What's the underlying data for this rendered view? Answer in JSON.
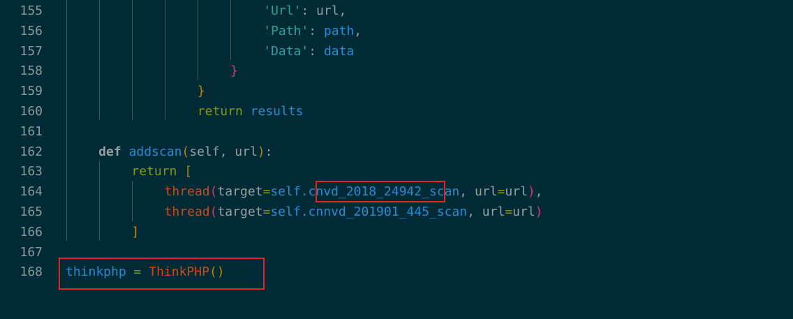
{
  "editor": {
    "lines": [
      {
        "num": "155",
        "parts": [
          [
            "str",
            "'Url'"
          ],
          [
            "name",
            ": url,"
          ]
        ]
      },
      {
        "num": "156",
        "parts": [
          [
            "str",
            "'Path'"
          ],
          [
            "name",
            ": "
          ],
          [
            "attr",
            "path"
          ],
          [
            "name",
            ","
          ]
        ]
      },
      {
        "num": "157",
        "parts": [
          [
            "str",
            "'Data'"
          ],
          [
            "name",
            ": "
          ],
          [
            "attr",
            "data"
          ]
        ]
      },
      {
        "num": "158",
        "parts": [
          [
            "br-pink",
            "}"
          ]
        ]
      },
      {
        "num": "159",
        "parts": [
          [
            "br-yel",
            "}"
          ]
        ]
      },
      {
        "num": "160",
        "parts": [
          [
            "kw",
            "return "
          ],
          [
            "attr",
            "results"
          ]
        ]
      },
      {
        "num": "161",
        "parts": []
      },
      {
        "num": "162",
        "parts": [
          [
            "kw-def",
            "def "
          ],
          [
            "fn",
            "addscan"
          ],
          [
            "br-yel",
            "("
          ],
          [
            "name",
            "self, url"
          ],
          [
            "br-yel",
            ")"
          ],
          [
            "name",
            ":"
          ]
        ]
      },
      {
        "num": "163",
        "parts": [
          [
            "kw",
            "return "
          ],
          [
            "br-yel",
            "["
          ]
        ]
      },
      {
        "num": "164",
        "parts": [
          [
            "call",
            "thread"
          ],
          [
            "br-pink",
            "("
          ],
          [
            "name",
            "target"
          ],
          [
            "kw",
            "="
          ],
          [
            "attr",
            "self.cnvd_2018_24942_scan"
          ],
          [
            "name",
            ", url"
          ],
          [
            "kw",
            "="
          ],
          [
            "name",
            "url"
          ],
          [
            "br-pink",
            ")"
          ],
          [
            "name",
            ","
          ]
        ]
      },
      {
        "num": "165",
        "parts": [
          [
            "call",
            "thread"
          ],
          [
            "br-pink",
            "("
          ],
          [
            "name",
            "target"
          ],
          [
            "kw",
            "="
          ],
          [
            "attr",
            "self.cnnvd_201901_445_scan"
          ],
          [
            "name",
            ", url"
          ],
          [
            "kw",
            "="
          ],
          [
            "name",
            "url"
          ],
          [
            "br-pink",
            ")"
          ]
        ]
      },
      {
        "num": "166",
        "parts": [
          [
            "br-yel",
            "]"
          ]
        ]
      },
      {
        "num": "167",
        "parts": []
      },
      {
        "num": "168",
        "parts": [
          [
            "attr",
            "thinkphp"
          ],
          [
            "name",
            " "
          ],
          [
            "kw",
            "="
          ],
          [
            "name",
            " "
          ],
          [
            "call",
            "ThinkPHP"
          ],
          [
            "br-yel",
            "()"
          ]
        ]
      }
    ]
  },
  "colors": {
    "background": "#002b36",
    "line_number": "#8a9a9b",
    "keyword": "#859900",
    "string": "#2aa198",
    "identifier_blue": "#268bd2",
    "call_orange": "#cb4b16",
    "annotation_box": "#e0262a"
  }
}
